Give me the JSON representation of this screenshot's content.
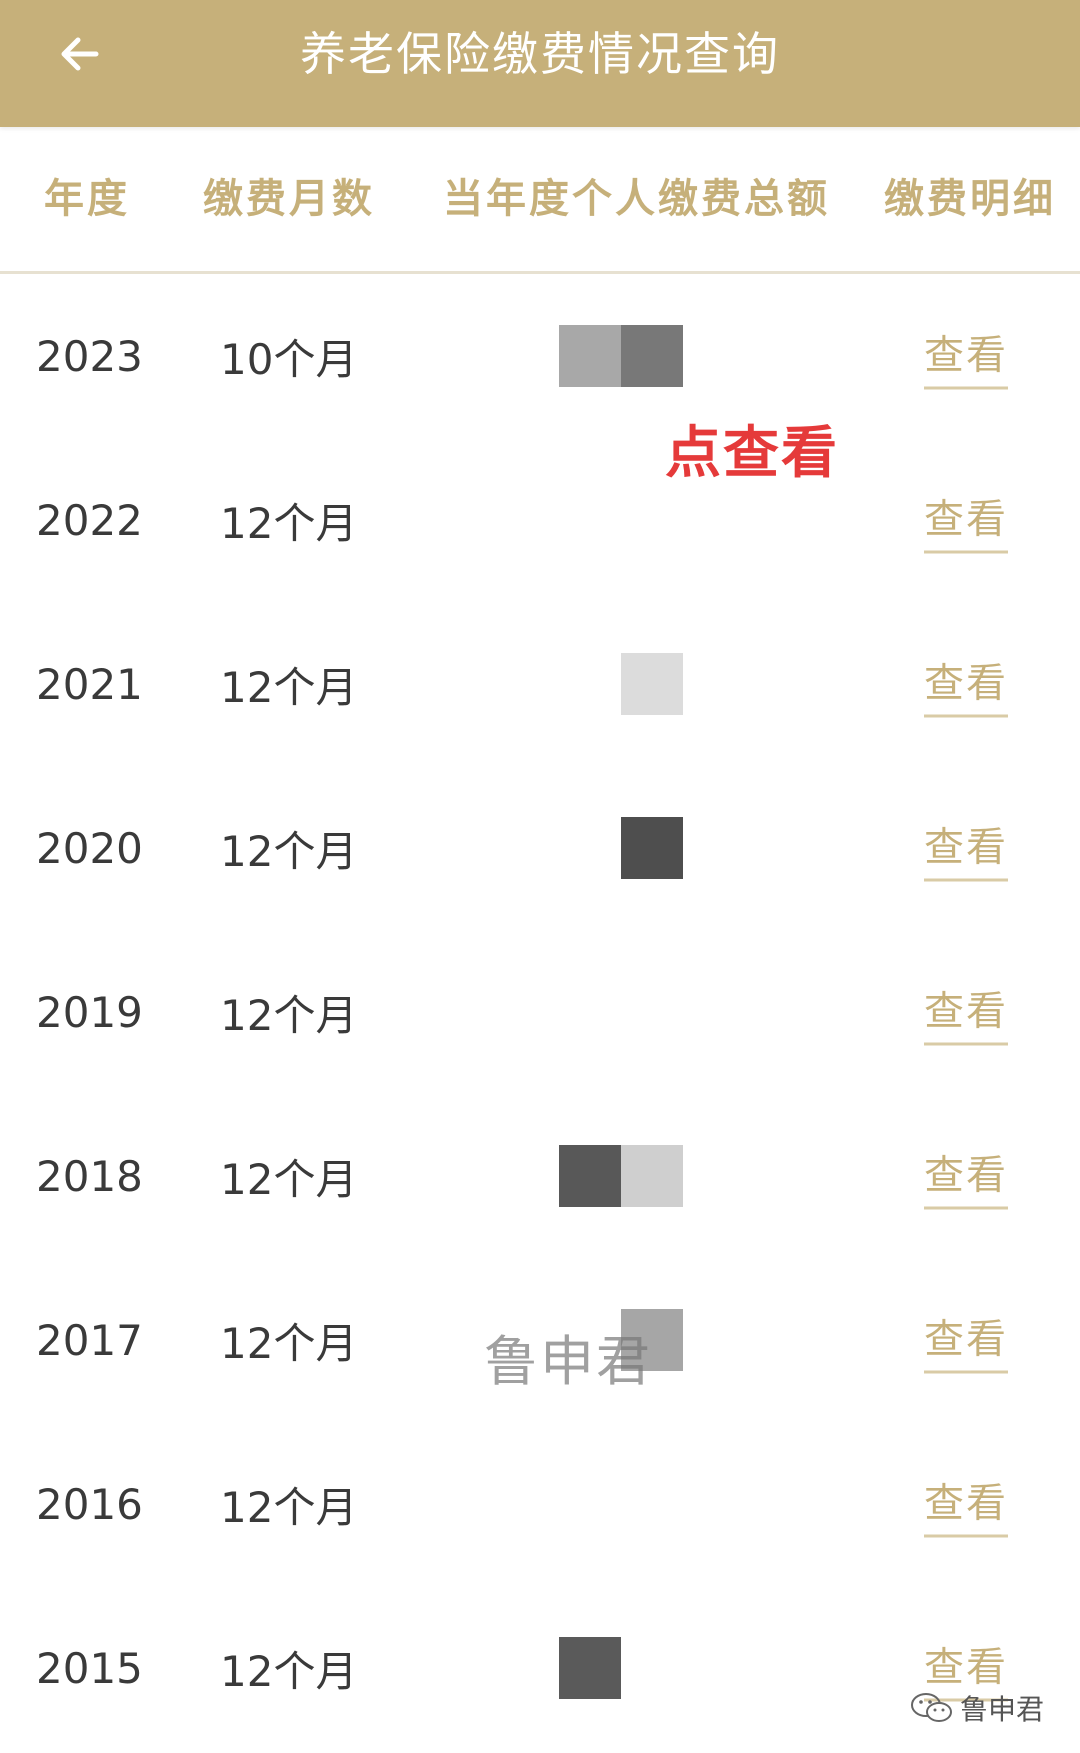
{
  "header": {
    "back_icon": "arrow-left-icon",
    "title": "养老保险缴费情况查询",
    "background": "#c6b07a"
  },
  "table": {
    "columns": [
      "年度",
      "缴费月数",
      "当年度个人缴费总额",
      "缴费明细"
    ],
    "rows": [
      {
        "year": "2023",
        "months": "10个月",
        "amount_blocks": [
          "#a8a8a8",
          "#787878"
        ],
        "action": "查看"
      },
      {
        "year": "2022",
        "months": "12个月",
        "amount_blocks": [
          "#ffffff",
          "#ffffff"
        ],
        "action": "查看"
      },
      {
        "year": "2021",
        "months": "12个月",
        "amount_blocks": [
          "#ffffff",
          "#dcdcdc"
        ],
        "action": "查看"
      },
      {
        "year": "2020",
        "months": "12个月",
        "amount_blocks": [
          "#ffffff",
          "#4e4e4e"
        ],
        "action": "查看"
      },
      {
        "year": "2019",
        "months": "12个月",
        "amount_blocks": [
          "#ffffff",
          "#ffffff"
        ],
        "action": "查看"
      },
      {
        "year": "2018",
        "months": "12个月",
        "amount_blocks": [
          "#585858",
          "#cfcfcf"
        ],
        "action": "查看"
      },
      {
        "year": "2017",
        "months": "12个月",
        "amount_blocks": [
          "#ffffff",
          "#a6a6a6"
        ],
        "action": "查看"
      },
      {
        "year": "2016",
        "months": "12个月",
        "amount_blocks": [
          "#ffffff",
          "#ffffff"
        ],
        "action": "查看"
      },
      {
        "year": "2015",
        "months": "12个月",
        "amount_blocks": [
          "#5a5a5a",
          "#ffffff"
        ],
        "action": "查看"
      }
    ]
  },
  "annotation": "点查看",
  "watermark": "鲁申君",
  "footer_watermark": {
    "icon": "wechat-icon",
    "text": "鲁申君"
  },
  "colors": {
    "accent": "#c6b07a",
    "annotation": "#e53a3a",
    "text": "#3a3a3a"
  }
}
